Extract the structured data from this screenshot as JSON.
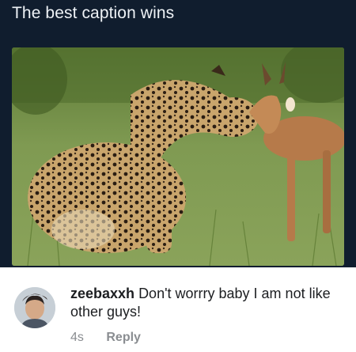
{
  "post": {
    "caption": "The best caption wins"
  },
  "comment": {
    "username": "zeebaxxh",
    "text": "Don't worrry baby  I am not like other guys!",
    "timestamp": "4s",
    "reply_label": "Reply"
  },
  "colors": {
    "post_background": "#101d2e",
    "caption_text": "#eef2f6",
    "comment_text": "#1c1e21",
    "meta_text": "#8a8d91"
  }
}
